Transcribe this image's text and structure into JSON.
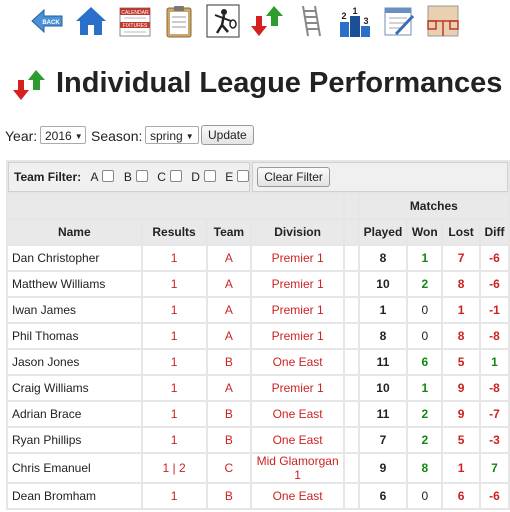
{
  "toolbar": {
    "back_label": "BACK",
    "calendar_label_top": "CALENDAR",
    "calendar_label_bottom": "FIXTURES"
  },
  "page": {
    "title": "Individual League Performances"
  },
  "filters": {
    "year_label": "Year:",
    "year_value": "2016",
    "season_label": "Season:",
    "season_value": "spring",
    "update_label": "Update"
  },
  "team_filter": {
    "label": "Team Filter:",
    "letters": [
      "A",
      "B",
      "C",
      "D",
      "E"
    ],
    "clear_label": "Clear Filter"
  },
  "table": {
    "group_header": "Matches",
    "columns": [
      "Name",
      "Results",
      "Team",
      "Division",
      "",
      "Played",
      "Won",
      "Lost",
      "Diff"
    ],
    "rows": [
      {
        "name": "Dan Christopher",
        "results": "1",
        "team": "A",
        "division": "Premier 1",
        "played": "8",
        "won": "1",
        "lost": "7",
        "diff": "-6"
      },
      {
        "name": "Matthew Williams",
        "results": "1",
        "team": "A",
        "division": "Premier 1",
        "played": "10",
        "won": "2",
        "lost": "8",
        "diff": "-6"
      },
      {
        "name": "Iwan James",
        "results": "1",
        "team": "A",
        "division": "Premier 1",
        "played": "1",
        "won": "0",
        "lost": "1",
        "diff": "-1"
      },
      {
        "name": "Phil Thomas",
        "results": "1",
        "team": "A",
        "division": "Premier 1",
        "played": "8",
        "won": "0",
        "lost": "8",
        "diff": "-8"
      },
      {
        "name": "Jason Jones",
        "results": "1",
        "team": "B",
        "division": "One East",
        "played": "11",
        "won": "6",
        "lost": "5",
        "diff": "1"
      },
      {
        "name": "Craig Williams",
        "results": "1",
        "team": "A",
        "division": "Premier 1",
        "played": "10",
        "won": "1",
        "lost": "9",
        "diff": "-8"
      },
      {
        "name": "Adrian Brace",
        "results": "1",
        "team": "B",
        "division": "One East",
        "played": "11",
        "won": "2",
        "lost": "9",
        "diff": "-7"
      },
      {
        "name": "Ryan Phillips",
        "results": "1",
        "team": "B",
        "division": "One East",
        "played": "7",
        "won": "2",
        "lost": "5",
        "diff": "-3"
      },
      {
        "name": "Chris Emanuel",
        "results": "1 | 2",
        "team": "C",
        "division": "Mid Glamorgan 1",
        "played": "9",
        "won": "8",
        "lost": "1",
        "diff": "7"
      },
      {
        "name": "Dean Bromham",
        "results": "1",
        "team": "B",
        "division": "One East",
        "played": "6",
        "won": "0",
        "lost": "6",
        "diff": "-6"
      }
    ]
  },
  "colors": {
    "link_red": "#cc2222",
    "win_green": "#118811",
    "header_gray": "#e9e9e9"
  }
}
